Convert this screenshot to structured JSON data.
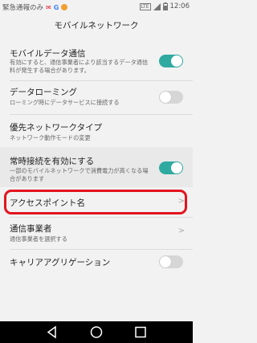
{
  "status_bar": {
    "left_text": "緊急通報のみ",
    "time": "12:06",
    "badge": "LTE",
    "icons": [
      "gmail-icon",
      "google-icon",
      "app-icon-orange",
      "hd-icon",
      "signal-icon",
      "battery-icon"
    ]
  },
  "app_bar": {
    "title": "モバイルネットワーク"
  },
  "settings": [
    {
      "title": "モバイルデータ通信",
      "sub1": "有効にすると、通信事業者により該当するデータ通信",
      "sub2": "料が発生する場合があります。",
      "control": "toggle",
      "checked": true
    },
    {
      "title": "データローミング",
      "sub1": "ローミング時にデータサービスに接続する",
      "control": "toggle",
      "checked": false
    },
    {
      "title": "優先ネットワークタイプ",
      "sub1": "ネットワーク動作モードの変更",
      "control": "none"
    },
    {
      "title": "常時接続を有効にする",
      "sub1": "一部のモバイルネットワークで消費電力が高くなる場",
      "sub2": "合があります",
      "control": "toggle",
      "checked": true
    },
    {
      "title": "アクセスポイント名",
      "control": "chevron"
    },
    {
      "title": "通信事業者",
      "sub1": "通信事業者を選択する",
      "control": "chevron"
    },
    {
      "title": "キャリアアグリゲーション",
      "control": "toggle",
      "checked": false
    }
  ],
  "colors": {
    "accent": "#2eaaa1",
    "highlight": "#e3141e",
    "background": "#f2f2f2"
  },
  "nav": {
    "buttons": [
      "back-icon",
      "home-icon",
      "recents-icon"
    ]
  }
}
